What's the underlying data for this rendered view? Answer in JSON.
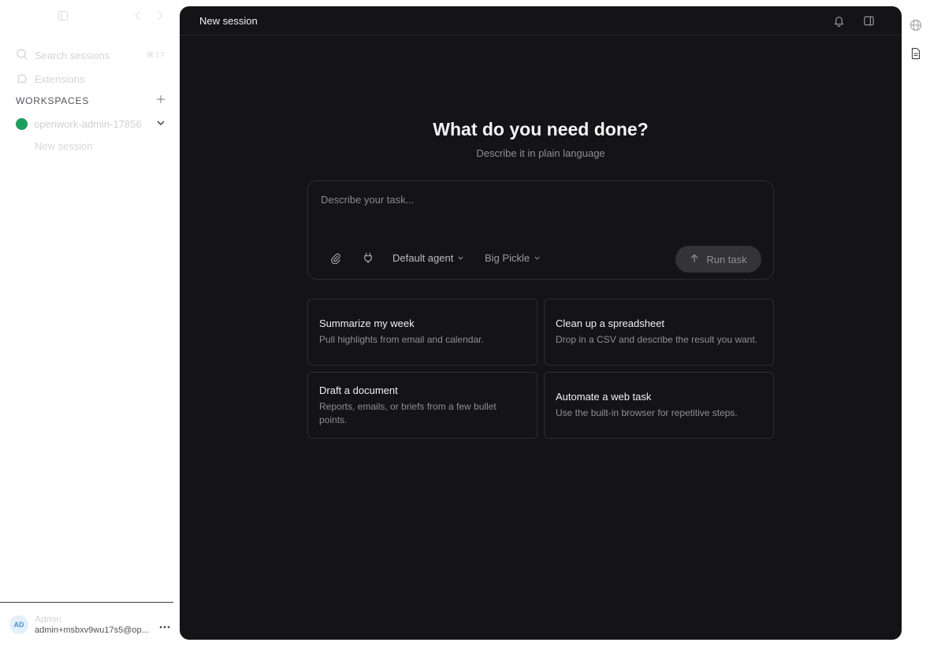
{
  "sidebar": {
    "search_placeholder": "Search sessions",
    "search_shortcut": "⌘⇧F",
    "extensions_label": "Extensions",
    "workspaces_label": "WORKSPACES",
    "workspace": {
      "name": "openwork-admin-17856",
      "sessions": [
        "New session"
      ]
    },
    "user": {
      "initials": "AD",
      "name": "Admin",
      "email": "admin+msbxv9wu17s5@op..."
    }
  },
  "main": {
    "header_title": "New session",
    "hero_title": "What do you need done?",
    "hero_subtitle": "Describe it in plain language",
    "composer": {
      "placeholder": "Describe your task...",
      "value": "",
      "agent": "Default agent",
      "model": "Big Pickle",
      "run_label": "Run task"
    },
    "suggestions": [
      {
        "title": "Summarize my week",
        "desc": "Pull highlights from email and calendar."
      },
      {
        "title": "Clean up a spreadsheet",
        "desc": "Drop in a CSV and describe the result you want."
      },
      {
        "title": "Draft a document",
        "desc": "Reports, emails, or briefs from a few bullet points."
      },
      {
        "title": "Automate a web task",
        "desc": "Use the built-in browser for repetitive steps."
      }
    ]
  },
  "colors": {
    "main_background": "#141416",
    "workspace_dot": "#1e9e5c",
    "run_button": "#343438"
  },
  "icons": {
    "sidebar": [
      "sidebar-toggle-icon",
      "back-icon",
      "forward-icon",
      "search-icon",
      "puzzle-icon",
      "plus-icon",
      "chevron-down-icon",
      "more-icon"
    ],
    "header": [
      "bell-icon",
      "panel-icon"
    ],
    "composer": [
      "paperclip-icon",
      "plug-icon",
      "arrow-up-icon"
    ],
    "rail": [
      "globe-icon",
      "document-icon"
    ]
  }
}
